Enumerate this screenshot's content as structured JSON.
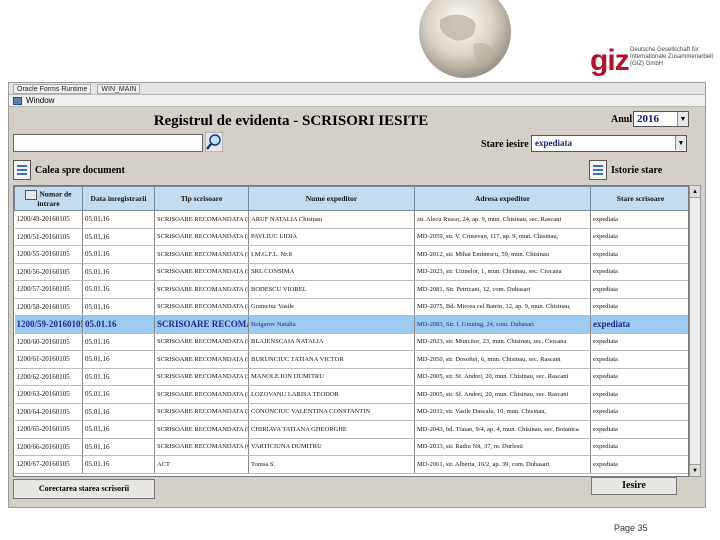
{
  "brand": {
    "logo_text": "giz",
    "subtitle": "Deutsche Gesellschaft für Internationale Zusammenarbeit (GIZ) GmbH"
  },
  "window": {
    "title_tabs": [
      "Oracle Forms Runtime",
      "WIN_MAIN"
    ],
    "menu": "Window"
  },
  "form": {
    "title": "Registrul de evidenta - SCRISORI IESITE",
    "year_label": "Anul",
    "year_value": "2016",
    "status_label": "Stare iesire",
    "status_value": "expediata",
    "search_value": "",
    "path_button": "Calea spre document",
    "history_button": "Istorie stare"
  },
  "table": {
    "headers": [
      "Numar de intrare",
      "Data inregistrarii",
      "Tip scrisoare",
      "Nume expeditor",
      "Adresa expeditor",
      "Stare scrisoare"
    ],
    "rows": [
      [
        "1200/49-20160105",
        "05.01.16",
        "SCRISOARE RECOMANDATA (SARA 47",
        "ARUF NATALIA Chisinau",
        "str. Alecu Russo, 24, ap. 9, mun. Chisinau, sec. Rascani",
        "expediata"
      ],
      [
        "1200/51-20160105",
        "05.01.16",
        "SCRISOARE RECOMANDATA (SARA 47",
        "PAVLIUC LIDIA",
        "MD-2059, str. V. Crusevan, 117, ap. 9, mun. Chisinau,",
        "expediata"
      ],
      [
        "1200/55-20160105",
        "05.01.16",
        "SCRISOARE RECOMANDATA (SARA 47",
        "I.M.G.F.L. Nr.8",
        "MD-2012, str. Mihai Eminescu, 59, mun. Chisinau",
        "expediata"
      ],
      [
        "1200/56-20160105",
        "05.01.16",
        "SCRISOARE RECOMANDATA (SARA 47",
        "SRL CONSIMA",
        "MD-2023, str. Uzinelor, 1, mun. Chisinau, sec. Ciocana",
        "expediata"
      ],
      [
        "1200/57-20160105",
        "05.01.16",
        "SCRISOARE RECOMANDATA (SARA 47",
        "BODESCU VIOREL",
        "MD-2081, Str. Petricani, 12, com. Dubasari",
        "expediata"
      ],
      [
        "1200/58-20160105",
        "05.01.16",
        "SCRISOARE RECOMANDATA (SARA 47",
        "Gramciuc Vasile",
        "MD-2075, Bd. Mircea cel Batrin, 12, ap. 9, mun. Chisinau,",
        "expediata"
      ],
      [
        "1200/59-20160105",
        "05.01.16",
        "SCRISOARE RECOMANDATA",
        "Bolgarov Natalia",
        "MD-2083, Str. I. Ginning, 24, com. Dubasari",
        "expediata"
      ],
      [
        "1200/60-20160105",
        "05.01.16",
        "SCRISOARE RECOMANDATA (SARA 47",
        "BLAJENSCAIA NATALIA",
        "MD-2023, str. Muncitor, 23, mun. Chisinau, sec. Ciocana",
        "expediata"
      ],
      [
        "1200/61-20160105",
        "05.01.16",
        "SCRISOARE RECOMANDATA (SARA 47",
        "BURUNCIUC TATIANA VICTOR",
        "MD-2050, str. Dosoftei, 6, mun. Chisinau, sec. Rascani",
        "expediata"
      ],
      [
        "1200/62-20160105",
        "05.01.16",
        "SCRISOARE RECOMANDATA (SARA 47",
        "MANOLE ION DUMITRU",
        "MD-2005, str. Sf. Andrei, 20, mun. Chisinau, sec. Rascani",
        "expediata"
      ],
      [
        "1200/63-20160105",
        "05.01.16",
        "SCRISOARE RECOMANDATA (SARA 47",
        "LOZOVANU LARISA TEODOR",
        "MD-2005, str. Sf. Andrei, 20, mun. Chisinau, sec. Rascani",
        "expediata"
      ],
      [
        "1200/64-20160105",
        "05.01.16",
        "SCRISOARE RECOMANDATA (SARA 47",
        "CONONCIUC VALENTINA CONSTANTIN",
        "MD-2031, str. Vasile Dascalu, 10, mun. Chisinau,",
        "expediata"
      ],
      [
        "1200/65-20160105",
        "05.01.16",
        "SCRISOARE RECOMANDATA (SARA 47",
        "CHIRIAVA TATIANA GHEORGHE",
        "MD-2043, bd. Traian, 9/4, ap. 4, mun. Chisinau, sec. Botanica",
        "expediata"
      ],
      [
        "1200/66-20160105",
        "05.01.16",
        "SCRISOARE RECOMANDATA (CI 470",
        "VARTICIUNA DUMITRU",
        "MD-2033, str. Radiu Nit, 37, m. Durlesti",
        "expediata"
      ],
      [
        "1200/67-20160105",
        "05.01.16",
        "ACT",
        "Tomsa S.",
        "MD-2061, str. Alberta, 16/2, ap. 39, com. Dubasari",
        "expediata"
      ]
    ]
  },
  "buttons": {
    "correct": "Corectarea starea scrisorii",
    "exit": "Iesire"
  },
  "page": {
    "number": "Page 35"
  }
}
